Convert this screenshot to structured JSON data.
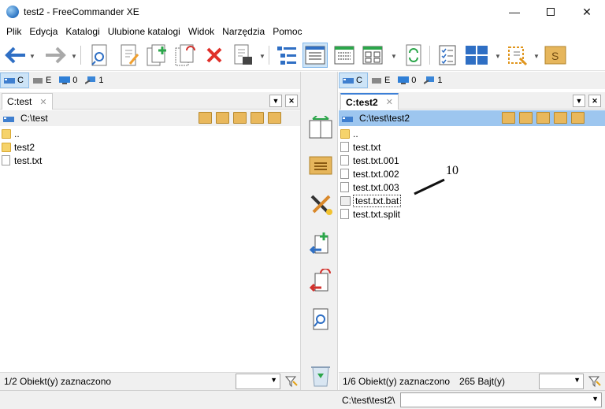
{
  "window": {
    "title": "test2 - FreeCommander XE"
  },
  "menu": [
    "Plik",
    "Edycja",
    "Katalogi",
    "Ulubione katalogi",
    "Widok",
    "Narzędzia",
    "Pomoc"
  ],
  "left_panel": {
    "drives": [
      {
        "label": "C",
        "icon": "hdd-icon"
      },
      {
        "label": "E",
        "icon": "removable-drive-icon"
      },
      {
        "label": "0",
        "icon": "monitor-icon"
      },
      {
        "label": "1",
        "icon": "network-icon"
      }
    ],
    "tab": "C:test",
    "path": "C:\\test",
    "files": [
      {
        "name": "..",
        "type": "folder"
      },
      {
        "name": "test2",
        "type": "folder"
      },
      {
        "name": "test.txt",
        "type": "file"
      }
    ],
    "status": "1/2 Obiekt(y) zaznaczono"
  },
  "right_panel": {
    "drives": [
      {
        "label": "C",
        "icon": "hdd-icon"
      },
      {
        "label": "E",
        "icon": "removable-drive-icon"
      },
      {
        "label": "0",
        "icon": "monitor-icon"
      },
      {
        "label": "1",
        "icon": "network-icon"
      }
    ],
    "tab": "C:test2",
    "path": "C:\\test\\test2",
    "files": [
      {
        "name": "..",
        "type": "folder"
      },
      {
        "name": "test.txt",
        "type": "file"
      },
      {
        "name": "test.txt.001",
        "type": "file"
      },
      {
        "name": "test.txt.002",
        "type": "file"
      },
      {
        "name": "test.txt.003",
        "type": "file"
      },
      {
        "name": "test.txt.bat",
        "type": "bat"
      },
      {
        "name": "test.txt.split",
        "type": "file"
      }
    ],
    "status": "1/6 Obiekt(y) zaznaczono",
    "status_size": "265 Bajt(y)"
  },
  "command_line": {
    "path": "C:\\test\\test2\\"
  },
  "annotation": {
    "label": "10"
  },
  "colors": {
    "accent": "#3c7fd6",
    "path_active": "#9dc6ef",
    "selection": "#cde4f7"
  }
}
